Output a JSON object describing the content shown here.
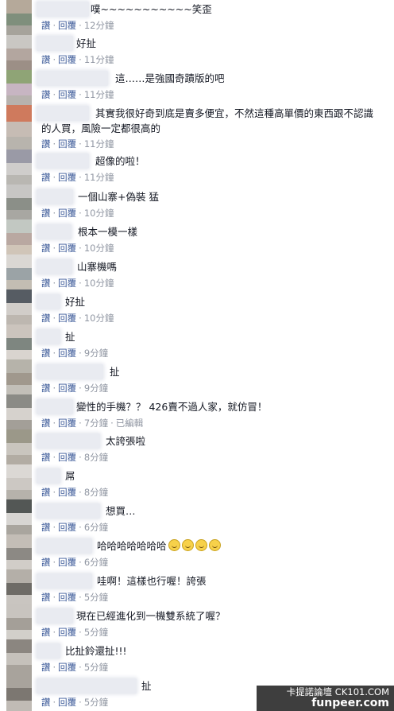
{
  "actions": {
    "like": "讚",
    "reply": "回覆",
    "edited": "已編輯"
  },
  "separator": "·",
  "comments": [
    {
      "text": "噗~~~~~~~~~~~笑歪",
      "time": "12分鐘"
    },
    {
      "text": "好扯",
      "time": "11分鐘"
    },
    {
      "text": "這……是強國奇蹟版的吧",
      "time": "11分鐘"
    },
    {
      "text": "其實我很好奇到底是賣多便宜，不然這種高單價的東西跟不認識的人買，風險一定都很高的",
      "time": "11分鐘"
    },
    {
      "text": "超像的啦！",
      "time": "11分鐘"
    },
    {
      "text": "一個山寨+偽裝 猛",
      "time": "10分鐘"
    },
    {
      "text": "根本一模一樣",
      "time": "10分鐘"
    },
    {
      "text": "山寨機嗎",
      "time": "10分鐘"
    },
    {
      "text": "好扯",
      "time": "10分鐘"
    },
    {
      "text": "扯",
      "time": "9分鐘"
    },
    {
      "text": "扯",
      "time": "9分鐘"
    },
    {
      "text": "變性的手機？？ 426賣不過人家，就仿冒！",
      "time": "7分鐘",
      "edited": true
    },
    {
      "text": "太誇張啦",
      "time": "8分鐘"
    },
    {
      "text": "屌",
      "time": "8分鐘"
    },
    {
      "text": "想買…",
      "time": "6分鐘"
    },
    {
      "text": "哈哈哈哈哈哈哈",
      "time": "6分鐘",
      "emoji_count": 4,
      "emoji_icon": "grinning-face-icon"
    },
    {
      "text": "哇啊！這樣也行喔！誇張",
      "time": "5分鐘"
    },
    {
      "text": "現在已經進化到一機雙系統了喔？",
      "time": "5分鐘"
    },
    {
      "text": "比扯鈴還扯!!!",
      "time": "5分鐘"
    },
    {
      "text": "扯",
      "time": "5分鐘"
    }
  ],
  "watermark": {
    "top": "卡提諾論壇 CK101.COM",
    "bottom": "funpeer.com"
  },
  "colors": {
    "link": "#3b5998",
    "meta": "#9197a3",
    "text": "#141823"
  }
}
